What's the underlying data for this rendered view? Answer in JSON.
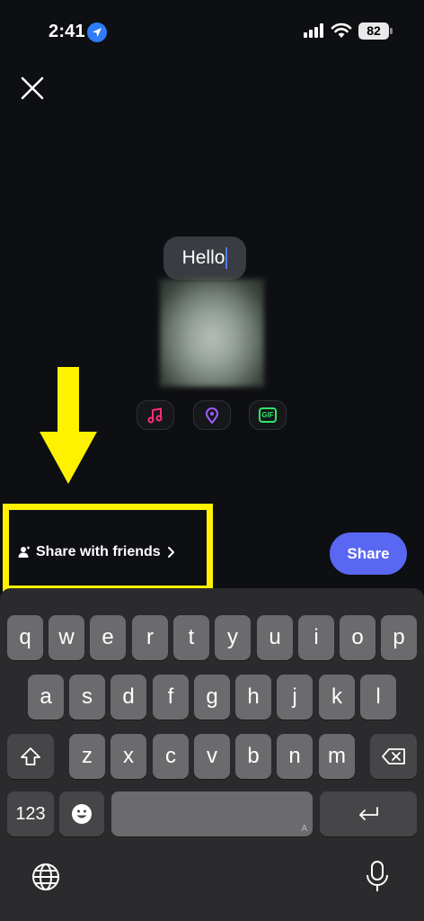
{
  "status_bar": {
    "time": "2:41",
    "battery": "82"
  },
  "composer": {
    "text": "Hello"
  },
  "tools": [
    {
      "icon": "music-note-icon",
      "color": "#ff2d7a"
    },
    {
      "icon": "location-pin-icon",
      "color": "#9d5cff"
    },
    {
      "icon": "gif-icon",
      "label": "GIF",
      "color": "#2ee86b"
    }
  ],
  "audience": {
    "label": "Share with friends"
  },
  "actions": {
    "share_label": "Share"
  },
  "annotation": {
    "color": "#fff200"
  },
  "keyboard": {
    "row1": [
      "q",
      "w",
      "e",
      "r",
      "t",
      "y",
      "u",
      "i",
      "o",
      "p"
    ],
    "row2": [
      "a",
      "s",
      "d",
      "f",
      "g",
      "h",
      "j",
      "k",
      "l"
    ],
    "row3": [
      "z",
      "x",
      "c",
      "v",
      "b",
      "n",
      "m"
    ],
    "numbers_label": "123",
    "space_hint": "A"
  },
  "colors": {
    "accent": "#5a67f2",
    "background": "#0e0f12"
  }
}
